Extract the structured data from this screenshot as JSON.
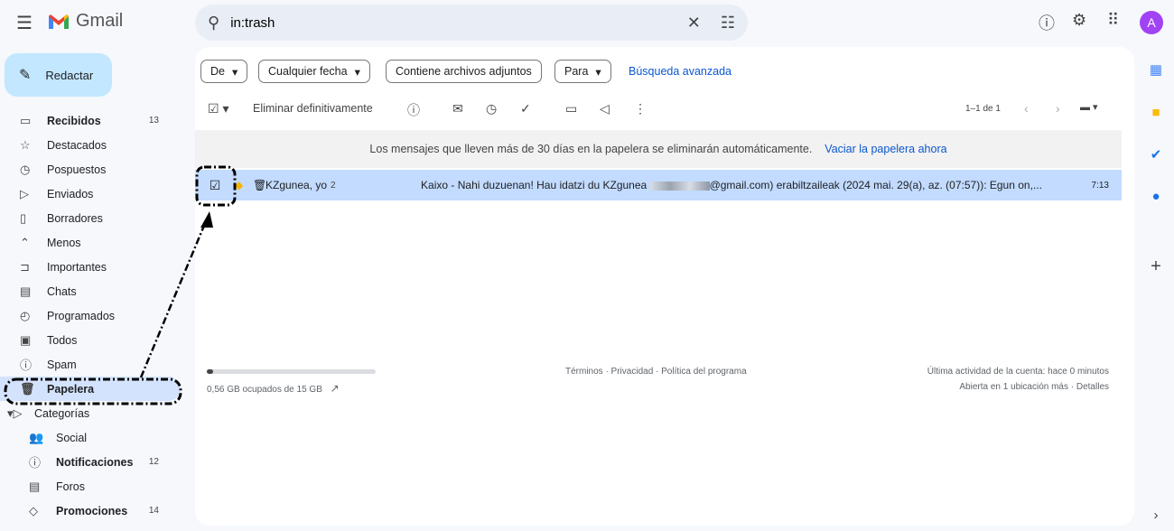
{
  "header": {
    "brand": "Gmail",
    "search_value": "in:trash"
  },
  "avatar_letter": "A",
  "compose_label": "Redactar",
  "sidebar": {
    "items": [
      {
        "label": "Recibidos",
        "count": "13",
        "icon": "inbox-icon",
        "bold": true
      },
      {
        "label": "Destacados",
        "icon": "star-icon"
      },
      {
        "label": "Pospuestos",
        "icon": "clock-icon"
      },
      {
        "label": "Enviados",
        "icon": "send-icon"
      },
      {
        "label": "Borradores",
        "icon": "draft-icon"
      },
      {
        "label": "Menos",
        "icon": "chevron-up-icon"
      },
      {
        "label": "Importantes",
        "icon": "important-icon"
      },
      {
        "label": "Chats",
        "icon": "chat-icon"
      },
      {
        "label": "Programados",
        "icon": "scheduled-icon"
      },
      {
        "label": "Todos",
        "icon": "all-mail-icon"
      },
      {
        "label": "Spam",
        "icon": "spam-icon"
      },
      {
        "label": "Papelera",
        "icon": "trash-icon",
        "selected": true
      },
      {
        "label": "Categorías",
        "icon": "label-icon"
      },
      {
        "label": "Social",
        "icon": "people-icon",
        "sub": true
      },
      {
        "label": "Notificaciones",
        "count": "12",
        "icon": "info-icon",
        "sub": true,
        "bold": true
      },
      {
        "label": "Foros",
        "icon": "forum-icon",
        "sub": true
      },
      {
        "label": "Promociones",
        "count": "14",
        "icon": "tag-icon",
        "sub": true,
        "bold": true
      }
    ]
  },
  "filters": {
    "from": "De",
    "date": "Cualquier fecha",
    "attachments": "Contiene archivos adjuntos",
    "to": "Para",
    "advanced": "Búsqueda avanzada"
  },
  "toolbar": {
    "delete_forever": "Eliminar definitivamente",
    "pagination": "1–1 de 1"
  },
  "notice": {
    "text": "Los mensajes que lleven más de 30 días en la papelera se eliminarán automáticamente.",
    "action": "Vaciar la papelera ahora"
  },
  "email": {
    "sender": "KZgunea, yo",
    "thread_count": "2",
    "snippet_before": "Kaixo - Nahi duzuenan! Hau idatzi du KZgunea",
    "snippet_after": "@gmail.com) erabiltzaileak (2024 mai. 29(a), az. (07:57)): Egun on,...",
    "time": "7:13"
  },
  "footer": {
    "storage": "0,56 GB ocupados de 15 GB",
    "storage_fraction": 0.037,
    "links": "Términos · Privacidad · Política del programa",
    "activity": "Última actividad de la cuenta: hace 0 minutos",
    "details": "Abierta en 1 ubicación más · Detalles"
  },
  "colors": {
    "selected_row": "#c2dbff",
    "accent": "#0b57d0",
    "compose": "#c2e7ff"
  }
}
